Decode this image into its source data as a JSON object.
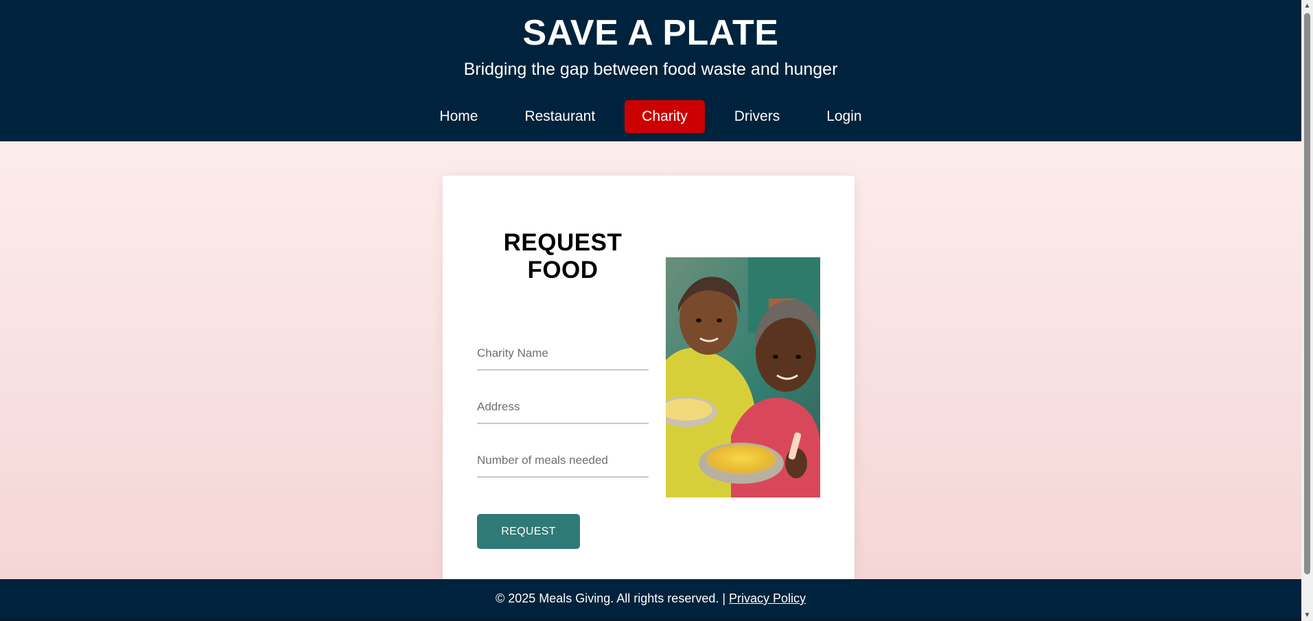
{
  "header": {
    "title": "SAVE A PLATE",
    "tagline": "Bridging the gap between food waste and hunger"
  },
  "nav": {
    "items": [
      {
        "label": "Home"
      },
      {
        "label": "Restaurant"
      },
      {
        "label": "Charity",
        "active": true
      },
      {
        "label": "Drivers"
      },
      {
        "label": "Login"
      }
    ],
    "active_color": "#cc0000"
  },
  "form": {
    "title": "REQUEST FOOD",
    "charity_name_placeholder": "Charity Name",
    "address_placeholder": "Address",
    "meals_placeholder": "Number of meals needed",
    "submit_label": "REQUEST",
    "button_color": "#2f7a78"
  },
  "footer": {
    "text": "© 2025 Meals Giving. All rights reserved. | ",
    "privacy_label": "Privacy Policy"
  },
  "colors": {
    "header_bg": "#00233d",
    "footer_bg": "#00233d"
  }
}
